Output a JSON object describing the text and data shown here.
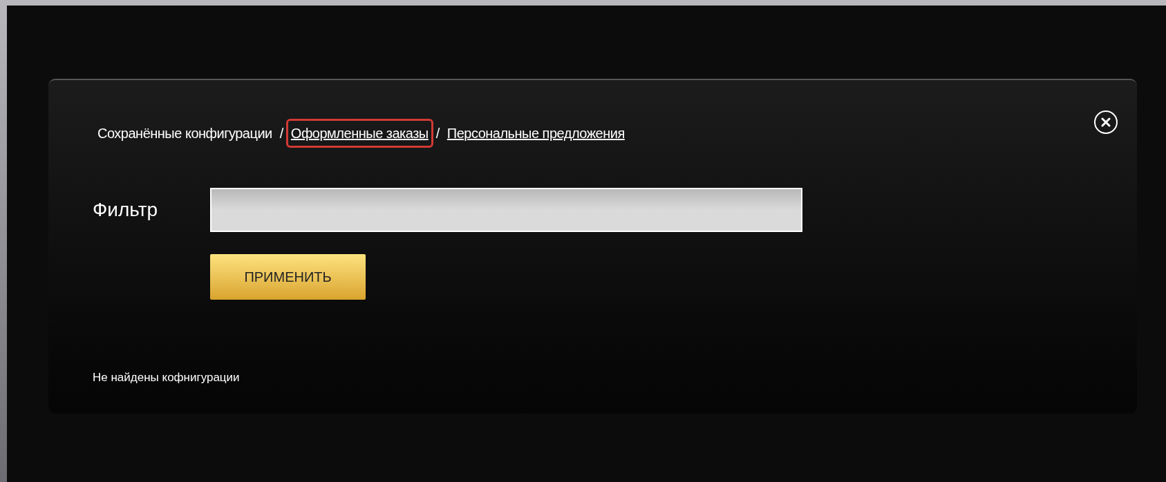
{
  "tabs": [
    {
      "label": "Сохранённые конфигурации",
      "selected": true,
      "highlighted": false
    },
    {
      "label": "Оформленные заказы",
      "selected": false,
      "highlighted": true
    },
    {
      "label": "Персональные предложения",
      "selected": false,
      "highlighted": false
    }
  ],
  "separator": "/",
  "filter": {
    "label": "Фильтр"
  },
  "apply_button": "ПРИМЕНИТЬ",
  "message": "Не найдены кофнигурации"
}
